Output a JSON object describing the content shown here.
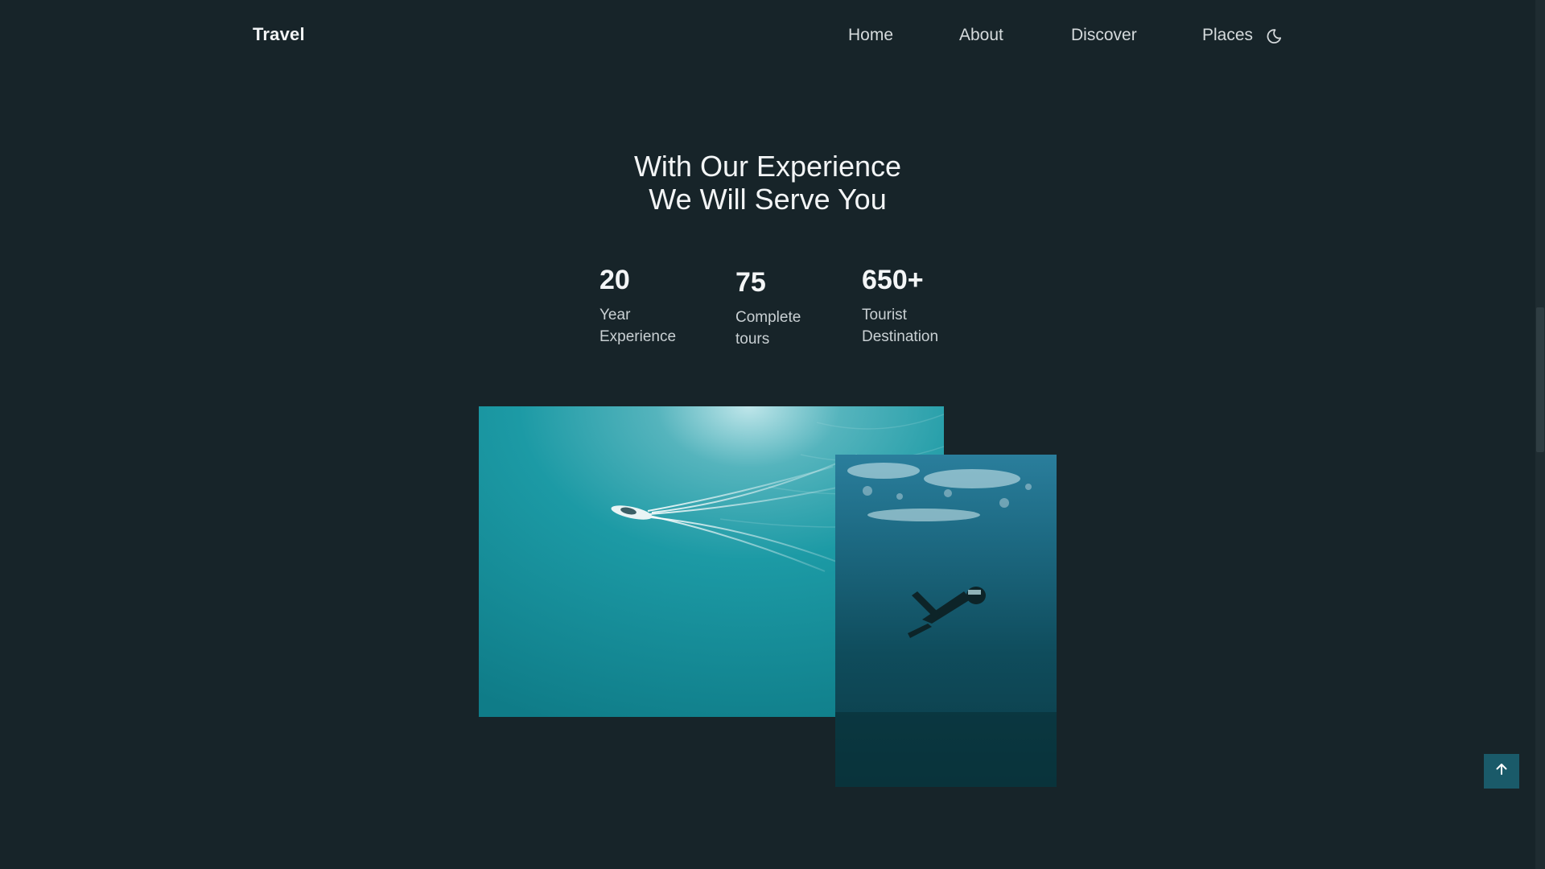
{
  "header": {
    "logo": "Travel",
    "nav": [
      "Home",
      "About",
      "Discover",
      "Places"
    ],
    "theme_toggle_icon": "moon-icon"
  },
  "hero": {
    "title_line1": "With Our Experience",
    "title_line2": "We Will Serve You"
  },
  "stats": [
    {
      "value": "20",
      "label_line1": "Year",
      "label_line2": "Experience"
    },
    {
      "value": "75",
      "label_line1": "Complete",
      "label_line2": "tours"
    },
    {
      "value": "650+",
      "label_line1": "Tourist",
      "label_line2": "Destination"
    }
  ],
  "images": [
    {
      "name": "ocean-boat-image"
    },
    {
      "name": "diver-underwater-image"
    }
  ],
  "scroll_up_icon": "arrow-up-icon",
  "colors": {
    "background": "#172429",
    "accent": "#1a5a69",
    "text": "#f3f5f6"
  }
}
